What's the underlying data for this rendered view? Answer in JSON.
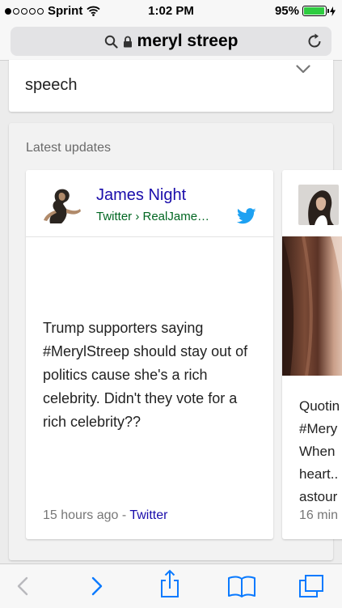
{
  "status_bar": {
    "carrier": "Sprint",
    "time": "1:02 PM",
    "battery": "95%",
    "battery_level": 0.95,
    "signal_bars_filled": 1,
    "signal_bars_total": 5
  },
  "browser": {
    "url_text": "meryl streep",
    "icons": [
      "search-icon",
      "lock-icon",
      "reload-icon"
    ]
  },
  "top_card": {
    "text": "speech",
    "icon": "chevron-down-icon"
  },
  "latest_updates": {
    "title": "Latest updates",
    "tweets": [
      {
        "author": "James Night",
        "source": "Twitter › RealJame…",
        "text": "Trump supporters saying #MerylStreep should stay out of politics cause she's a rich celebrity. Didn't they vote for a rich celebrity??",
        "time": "15 hours ago",
        "separator": "-",
        "link": "Twitter"
      },
      {
        "snippet_lines": [
          "Quotin",
          "#Mery",
          "When",
          "heart..",
          "astour"
        ],
        "time": "16 min"
      }
    ]
  },
  "toolbar": {
    "icons": [
      "back-icon",
      "forward-icon",
      "share-icon",
      "bookmarks-icon",
      "tabs-icon"
    ]
  },
  "colors": {
    "link_blue": "#1a0dab",
    "source_green": "#006621",
    "ios_blue": "#0a7aff",
    "twitter_blue": "#1da1f2",
    "battery_green": "#2ecc40"
  }
}
